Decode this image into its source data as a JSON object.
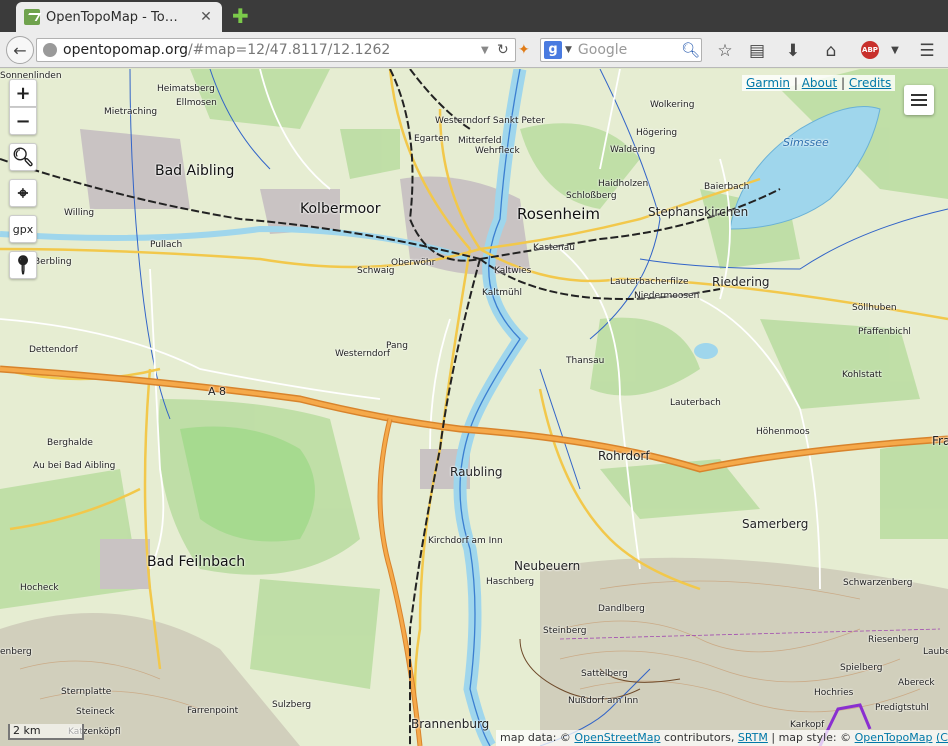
{
  "browser": {
    "tab_title": "OpenTopoMap - To…",
    "tab_close": "✕",
    "new_tab": "✚",
    "url_host": "opentopomap.org",
    "url_rest": "/#map=12/47.8117/12.1262",
    "search_placeholder": "Google",
    "search_engine": "g"
  },
  "map": {
    "zoom_in": "+",
    "zoom_out": "−",
    "gpx_label": "gpx",
    "links": {
      "garmin": "Garmin",
      "sep": "|",
      "about": "About",
      "credits": "Credits"
    },
    "scale_label": "2 km",
    "attribution": {
      "prefix": "map data: ©",
      "osm": "OpenStreetMap",
      "mid": "contributors,",
      "srtm": "SRTM",
      "style": "| map style: ©",
      "otm": "OpenTopoMap",
      "license": "(CC-BY-SA)"
    },
    "places": [
      {
        "name": "Bad Aibling",
        "cls": "big"
      },
      {
        "name": "Kolbermoor",
        "cls": "big"
      },
      {
        "name": "Rosenheim",
        "cls": "big"
      },
      {
        "name": "Stephanskirchen",
        "cls": "med"
      },
      {
        "name": "Riedering",
        "cls": "med"
      },
      {
        "name": "Raubling",
        "cls": "med"
      },
      {
        "name": "Rohrdorf",
        "cls": "med"
      },
      {
        "name": "Bad Feilnbach",
        "cls": "big"
      },
      {
        "name": "Samerberg",
        "cls": "med"
      },
      {
        "name": "Neubeuern",
        "cls": "med"
      },
      {
        "name": "Brannenburg",
        "cls": "med"
      },
      {
        "name": "Simssee",
        "cls": "water"
      },
      {
        "name": "Heimatsberg",
        "cls": ""
      },
      {
        "name": "Ellmosen",
        "cls": ""
      },
      {
        "name": "Mietraching",
        "cls": ""
      },
      {
        "name": "Westerndorf Sankt Peter",
        "cls": ""
      },
      {
        "name": "Wolkering",
        "cls": ""
      },
      {
        "name": "Egarten",
        "cls": ""
      },
      {
        "name": "Mitterfeld",
        "cls": ""
      },
      {
        "name": "Wehrfleck",
        "cls": ""
      },
      {
        "name": "Högering",
        "cls": ""
      },
      {
        "name": "Waldering",
        "cls": ""
      },
      {
        "name": "Haidholzen",
        "cls": ""
      },
      {
        "name": "Schloßberg",
        "cls": ""
      },
      {
        "name": "Baierbach",
        "cls": ""
      },
      {
        "name": "Willing",
        "cls": ""
      },
      {
        "name": "Pullach",
        "cls": ""
      },
      {
        "name": "Kastenau",
        "cls": ""
      },
      {
        "name": "Oberwöhr",
        "cls": ""
      },
      {
        "name": "Schwaig",
        "cls": ""
      },
      {
        "name": "Kaltwies",
        "cls": ""
      },
      {
        "name": "Kaltmühl",
        "cls": ""
      },
      {
        "name": "Lauterbacherfilze",
        "cls": ""
      },
      {
        "name": "Niedermoosen",
        "cls": ""
      },
      {
        "name": "Söllhuben",
        "cls": ""
      },
      {
        "name": "Pfaffenbichl",
        "cls": ""
      },
      {
        "name": "Berbling",
        "cls": ""
      },
      {
        "name": "Dettendorf",
        "cls": ""
      },
      {
        "name": "Westerndorf",
        "cls": ""
      },
      {
        "name": "Pang",
        "cls": ""
      },
      {
        "name": "Thansau",
        "cls": ""
      },
      {
        "name": "Kohlstatt",
        "cls": ""
      },
      {
        "name": "A 8",
        "cls": ""
      },
      {
        "name": "Lauterbach",
        "cls": ""
      },
      {
        "name": "Höhenmoos",
        "cls": ""
      },
      {
        "name": "Berghalde",
        "cls": ""
      },
      {
        "name": "Au bei Bad Aibling",
        "cls": ""
      },
      {
        "name": "Kirchdorf am Inn",
        "cls": ""
      },
      {
        "name": "Haschberg",
        "cls": ""
      },
      {
        "name": "Dandlberg",
        "cls": ""
      },
      {
        "name": "Steinberg",
        "cls": ""
      },
      {
        "name": "Schwarzenberg",
        "cls": ""
      },
      {
        "name": "Riesenberg",
        "cls": ""
      },
      {
        "name": "Laube",
        "cls": ""
      },
      {
        "name": "Spielberg",
        "cls": ""
      },
      {
        "name": "Abereck",
        "cls": ""
      },
      {
        "name": "Hochries",
        "cls": ""
      },
      {
        "name": "Predigtstuhl",
        "cls": ""
      },
      {
        "name": "Sattelberg",
        "cls": ""
      },
      {
        "name": "Nußdorf am Inn",
        "cls": ""
      },
      {
        "name": "Hocheck",
        "cls": ""
      },
      {
        "name": "Sternplatte",
        "cls": ""
      },
      {
        "name": "Farrenpoint",
        "cls": ""
      },
      {
        "name": "Steineck",
        "cls": ""
      },
      {
        "name": "Sulzberg",
        "cls": ""
      },
      {
        "name": "Katzenköpfl",
        "cls": ""
      },
      {
        "name": "Karkopf",
        "cls": ""
      },
      {
        "name": "Fras",
        "cls": "med"
      },
      {
        "name": "Sonnenlinden",
        "cls": ""
      },
      {
        "name": "enberg",
        "cls": ""
      },
      {
        "name": "Rosenheim",
        "cls": ""
      }
    ]
  }
}
